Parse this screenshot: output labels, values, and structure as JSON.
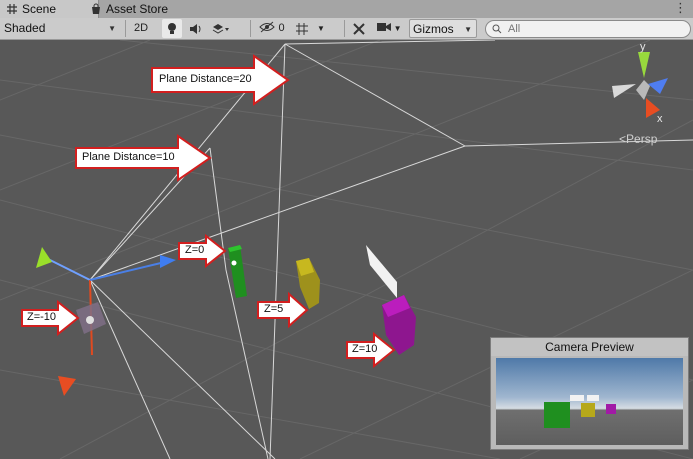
{
  "tabs": [
    {
      "label": "Scene",
      "icon": "grid-icon",
      "active": true
    },
    {
      "label": "Asset Store",
      "icon": "store-bag-icon",
      "active": false
    }
  ],
  "toolbar": {
    "shading_mode": "Shaded",
    "mode_2d": "2D",
    "hidden_count": "0",
    "gizmos_label": "Gizmos",
    "search_placeholder": "All"
  },
  "annotations": {
    "plane_far": "Plane Distance=20",
    "plane_near": "Plane Distance=10",
    "z0": "Z=0",
    "z_neg10": "Z=-10",
    "z5": "Z=5",
    "z10": "Z=10"
  },
  "orientation_gizmo": {
    "axis_y": "y",
    "axis_x": "x",
    "projection": "Persp"
  },
  "camera_preview": {
    "title": "Camera Preview"
  },
  "colors": {
    "cube_green": "#1f8f1f",
    "cube_yellow": "#b6a81a",
    "cube_magenta": "#a11aa6",
    "callout_red": "#d21f1f"
  }
}
